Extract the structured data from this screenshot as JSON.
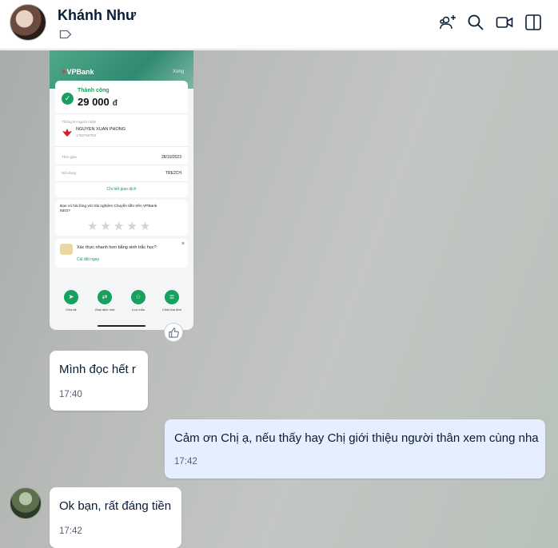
{
  "header": {
    "contact_name": "Khánh Như",
    "icons": [
      "tag-icon",
      "add-member-icon",
      "search-icon",
      "video-call-icon",
      "sidebar-toggle-icon"
    ]
  },
  "receipt": {
    "bank_name": "VPBank",
    "close_label": "Xong",
    "status": "Thành công",
    "amount": "29 000",
    "currency": "đ",
    "recipient_section": "Thông tin người nhận",
    "recipient_name": "NGUYEN XUAN PHONG",
    "recipient_account": "1750758793",
    "time_label": "Thời gian",
    "time_value": "28/10/2023",
    "content_label": "Nội dung",
    "content_value": "TRE2CH",
    "detail_link": "Chi tiết giao dịch",
    "survey_question": "Bạn có hài lòng với trải nghiệm Chuyển tiền trên VPBank NEO?",
    "stars": "★★★★★",
    "bio_question": "Xác thực nhanh hơn bằng sinh trắc học?",
    "bio_link": "Cài đặt ngay",
    "actions": [
      "Chia sẻ",
      "Giao dịch mới",
      "Lưu mẫu",
      "Chia hóa đơn"
    ]
  },
  "messages": [
    {
      "side": "received",
      "text": "Mình đọc hết r",
      "time": "17:40"
    },
    {
      "side": "sent",
      "text": "Cảm ơn Chị ạ, nếu thấy hay Chị giới thiệu người thân xem cùng nha",
      "time": "17:42"
    },
    {
      "side": "received",
      "text": "Ok bạn, rất đáng tiền",
      "time": "17:42"
    }
  ],
  "colors": {
    "accent_green": "#17a05e",
    "sent_bubble": "#e5efff",
    "header_bg": "#ffffff"
  }
}
